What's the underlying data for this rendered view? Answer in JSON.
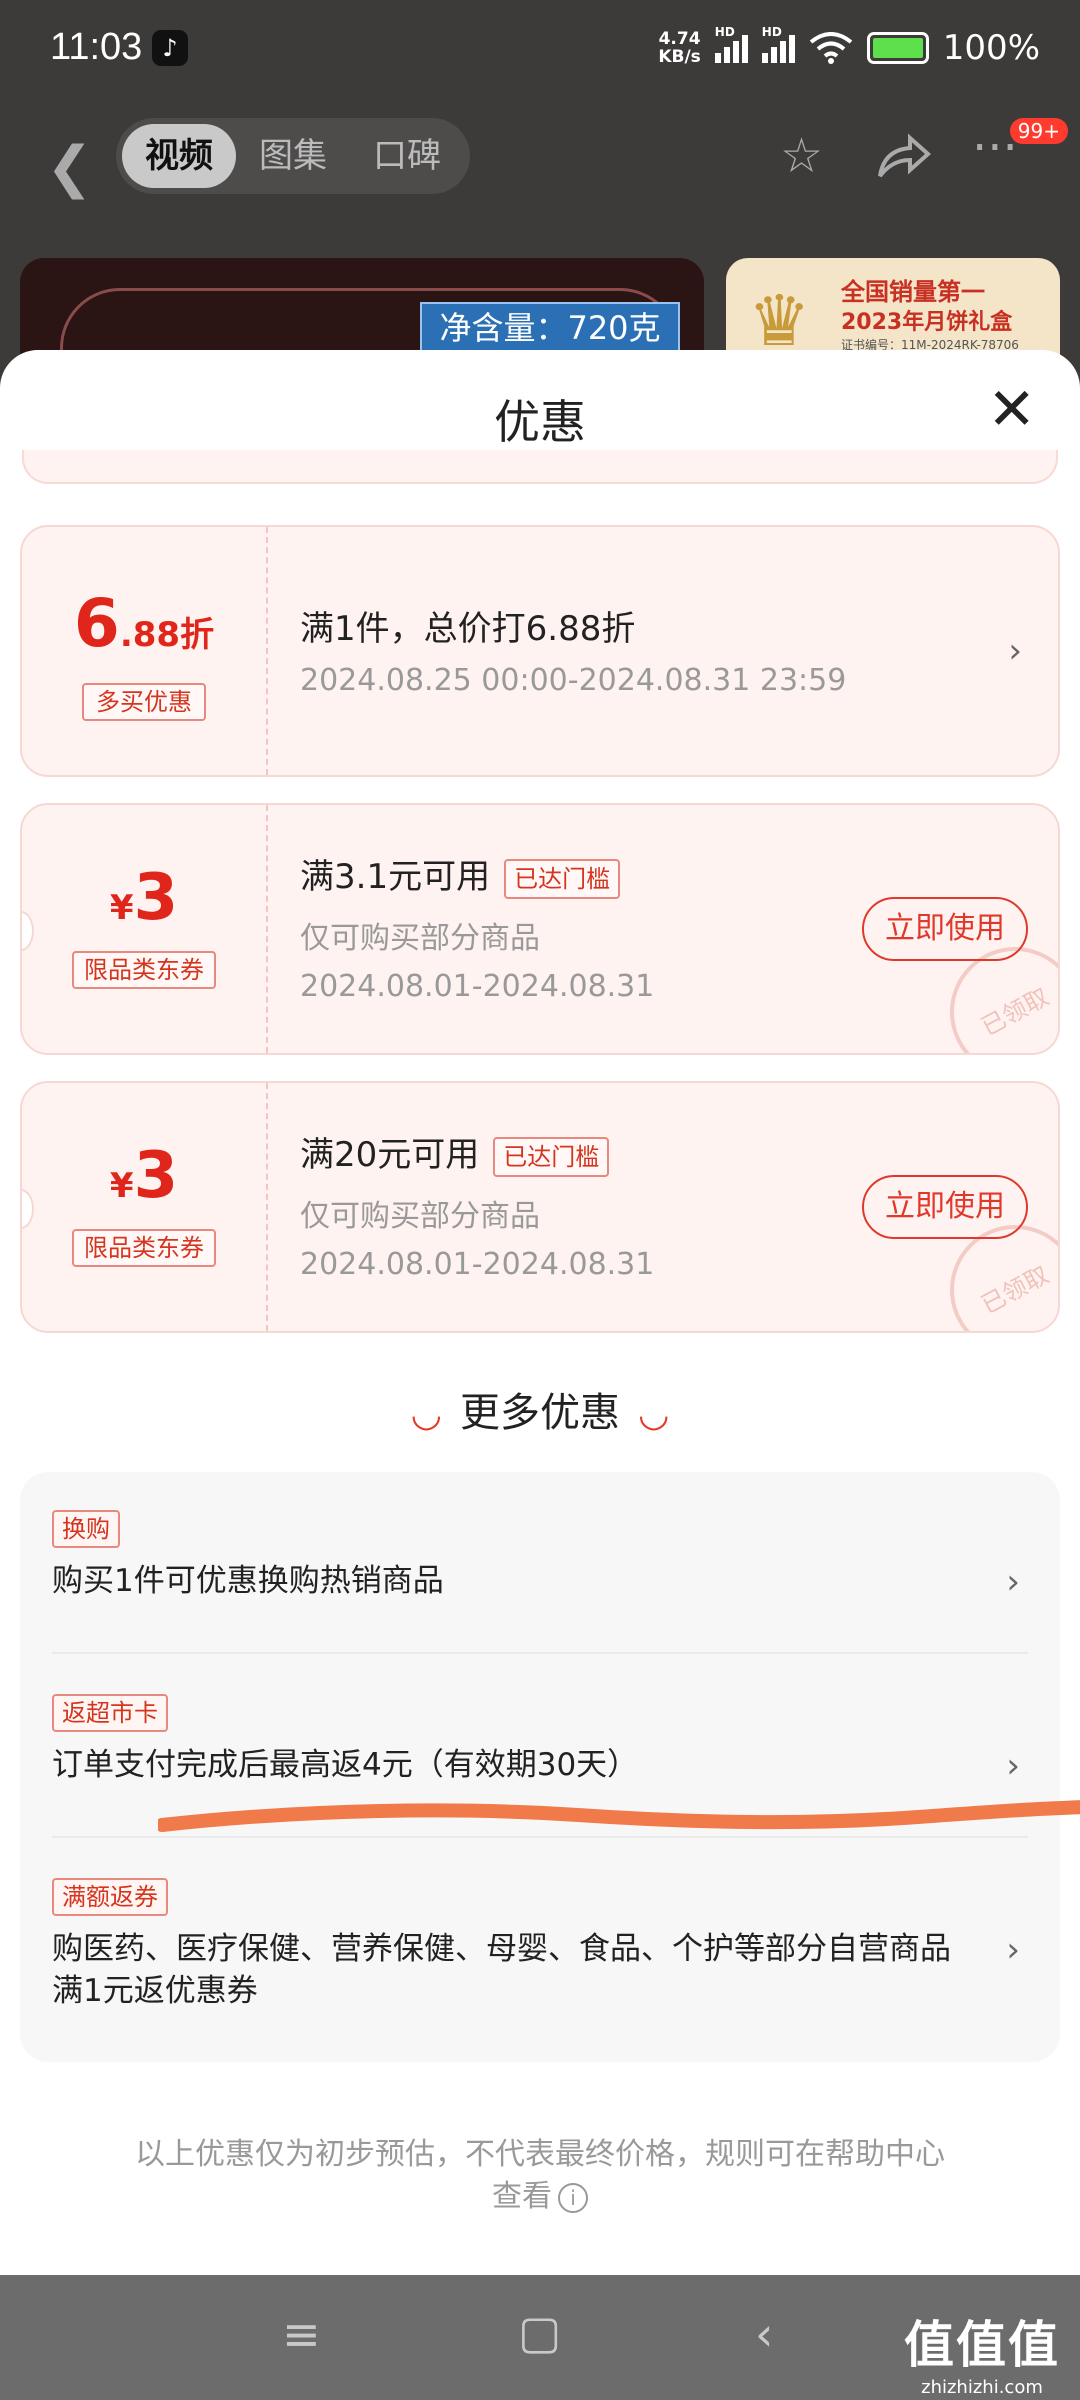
{
  "status_bar": {
    "time": "11:03",
    "app_icon": "tiktok-icon",
    "net_speed_value": "4.74",
    "net_speed_unit": "KB/s",
    "hd1": "HD",
    "hd2": "HD",
    "battery": "100%"
  },
  "header": {
    "tabs": [
      {
        "label": "视频"
      },
      {
        "label": "图集"
      },
      {
        "label": "口碑"
      }
    ],
    "badge": "99+"
  },
  "product": {
    "net_weight": "净含量：720克",
    "promo_line1": "全国销量第一",
    "promo_line2": "2023年月饼礼盒",
    "promo_line3": "证书编号：11M-2024RK-78706"
  },
  "sheet": {
    "title": "优惠",
    "coupons": [
      {
        "value_main": "6",
        "value_sub": ".88折",
        "tag": "多买优惠",
        "title": "满1件，总价打6.88折",
        "period": "2024.08.25 00:00-2024.08.31 23:59"
      },
      {
        "currency": "¥",
        "value_main": "3",
        "tag": "限品类东券",
        "title": "满3.1元可用",
        "reached": "已达门槛",
        "scope": "仅可购买部分商品",
        "period": "2024.08.01-2024.08.31",
        "button": "立即使用",
        "stamp": "已领取"
      },
      {
        "currency": "¥",
        "value_main": "3",
        "tag": "限品类东券",
        "title": "满20元可用",
        "reached": "已达门槛",
        "scope": "仅可购买部分商品",
        "period": "2024.08.01-2024.08.31",
        "button": "立即使用",
        "stamp": "已领取"
      }
    ],
    "more_title": "更多优惠",
    "more_items": [
      {
        "label": "换购",
        "desc": "购买1件可优惠换购热销商品"
      },
      {
        "label": "返超市卡",
        "desc": "订单支付完成后最高返4元（有效期30天）"
      },
      {
        "label": "满额返券",
        "desc": "购医药、医疗保健、营养保健、母婴、食品、个护等部分自营商品满1元返优惠券"
      }
    ],
    "disclaimer": "以上优惠仅为初步预估，不代表最终价格，规则可在帮助中心查看"
  },
  "watermark": {
    "brand": "值值值",
    "url": "zhizhizhi.com"
  },
  "colors": {
    "accent": "#e0261b",
    "coupon_bg": "#fff3f1",
    "annotation": "#f07a4a"
  }
}
